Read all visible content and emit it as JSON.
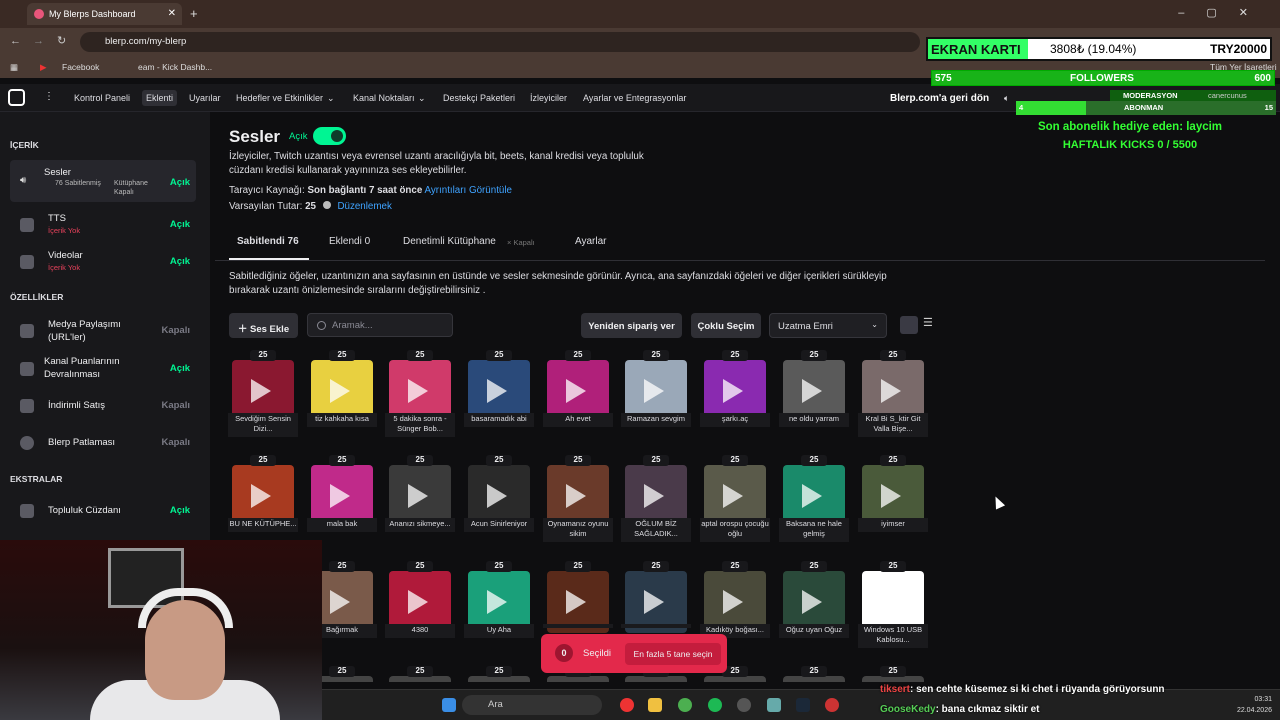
{
  "browser": {
    "tab_title": "My Blerps Dashboard",
    "url": "blerp.com/my-blerp",
    "bookmarks": [
      "Facebook",
      "Kick Dashb..."
    ],
    "bookmark_partial": "eam - Kick Dashb...",
    "other_bookmarks": "Tüm Yer İşaretleri"
  },
  "nav": {
    "items": [
      "Kontrol Paneli",
      "Eklenti",
      "Uyarılar",
      "Hedefler ve Etkinlikler",
      "Kanal Noktaları",
      "Destekçi Paketleri",
      "İzleyiciler",
      "Ayarlar ve Entegrasyonlar"
    ],
    "active": "Eklenti",
    "back": "Blerp.com'a geri dön"
  },
  "sidebar": {
    "section_content": "İÇERİK",
    "section_features": "ÖZELLİKLER",
    "section_extras": "EKSTRALAR",
    "items": [
      {
        "label": "Sesler",
        "sub": "76 Sabitlenmiş",
        "sub2": "Kütüphane Kapalı",
        "status": "Açık"
      },
      {
        "label": "TTS",
        "sub": "İçerik Yok",
        "status": "Açık"
      },
      {
        "label": "Videolar",
        "sub": "İçerik Yok",
        "status": "Açık"
      },
      {
        "label": "Medya Paylaşımı (URL'ler)",
        "status": "Kapalı"
      },
      {
        "label": "Kanal Puanlarının Devralınması",
        "status": "Açık"
      },
      {
        "label": "İndirimli Satış",
        "status": "Kapalı"
      },
      {
        "label": "Blerp Patlaması",
        "status": "Kapalı"
      },
      {
        "label": "Topluluk Cüzdanı",
        "status": "Açık"
      }
    ]
  },
  "main": {
    "title": "Sesler",
    "toggle_label": "Açık",
    "desc": "İzleyiciler, Twitch uzantısı veya evrensel uzantı aracılığıyla bit, beets, kanal kredisi veya topluluk cüzdanı kredisi kullanarak yayınınıza ses ekleyebilirler.",
    "source_label": "Tarayıcı Kaynağı:",
    "source_value": "Son bağlantı 7 saat önce",
    "source_link": "Ayrıntıları Görüntüle",
    "default_label": "Varsayılan Tutar:",
    "default_value": "25",
    "default_link": "Düzenlemek",
    "tabs": [
      "Sabitlendi 76",
      "Eklendi 0",
      "Denetimli Kütüphane",
      "Ayarlar"
    ],
    "tab_off": "× Kapalı",
    "pinned_desc": "Sabitlediğiniz öğeler, uzantınızın ana sayfasının en üstünde ve sesler sekmesinde görünür. Ayrıca, ana sayfanızdaki öğeleri ve diğer içerikleri sürükleyip bırakarak uzantı önizlemesinde sıralarını değiştirebilirsiniz .",
    "add_button": "Ses Ekle",
    "search_placeholder": "Aramak...",
    "reorder_button": "Yeniden sipariş ver",
    "multi_button": "Çoklu Seçim",
    "sort_value": "Uzatma Emri"
  },
  "cards": [
    {
      "cost": "25",
      "name": "Sevdiğim Sensin Dizi...",
      "color": "#8a1830"
    },
    {
      "cost": "25",
      "name": "tiz kahkaha kısa",
      "color": "#e8d040"
    },
    {
      "cost": "25",
      "name": "5 dakika sonra - Sünger Bob...",
      "color": "#d03a6a"
    },
    {
      "cost": "25",
      "name": "basaramadık abi",
      "color": "#2a4a7a"
    },
    {
      "cost": "25",
      "name": "Ah evet",
      "color": "#b0207a"
    },
    {
      "cost": "25",
      "name": "Ramazan sevgim",
      "color": "#9aa8b8"
    },
    {
      "cost": "25",
      "name": "şarkı.aç",
      "color": "#8a2ab0"
    },
    {
      "cost": "25",
      "name": "ne oldu yarram",
      "color": "#5a5a5a"
    },
    {
      "cost": "25",
      "name": "Kral Bi S_ktir Git Valla Bişe...",
      "color": "#7a6a6a"
    },
    {
      "cost": "25",
      "name": "BU NE KÜTÜPHE...",
      "color": "#a83a20"
    },
    {
      "cost": "25",
      "name": "mala bak",
      "color": "#c02a8a"
    },
    {
      "cost": "25",
      "name": "Ananızı sikmeye...",
      "color": "#3a3a3a"
    },
    {
      "cost": "25",
      "name": "Acun Sinirleniyor",
      "color": "#2a2a2a"
    },
    {
      "cost": "25",
      "name": "Oynamanız oyunu sikim",
      "color": "#6a3a2a"
    },
    {
      "cost": "25",
      "name": "OĞLUM BİZ SAĞLADIK...",
      "color": "#4a3a4a"
    },
    {
      "cost": "25",
      "name": "aptal orospu çocuğu oğlu",
      "color": "#5a5a4a"
    },
    {
      "cost": "25",
      "name": "Baksana ne hale gelmiş",
      "color": "#1a8a6a"
    },
    {
      "cost": "25",
      "name": "iyimser",
      "color": "#4a5a3a"
    },
    {
      "cost": "25",
      "name": "Bağırmak",
      "color": "#7a5a4a"
    },
    {
      "cost": "25",
      "name": "4380",
      "color": "#b01a3a"
    },
    {
      "cost": "25",
      "name": "Uy Aha",
      "color": "#1aa07a"
    },
    {
      "cost": "25",
      "name": "",
      "color": "#5a2a1a"
    },
    {
      "cost": "25",
      "name": "",
      "color": "#2a3a4a"
    },
    {
      "cost": "25",
      "name": "Kadıköy boğası...",
      "color": "#4a4a3a"
    },
    {
      "cost": "25",
      "name": "Oğuz uyan Oğuz",
      "color": "#2a4a3a"
    },
    {
      "cost": "25",
      "name": "Windows 10 USB Kablosu...",
      "color": "#ffffff"
    }
  ],
  "bottom_row_costs": [
    "25",
    "25",
    "25",
    "25",
    "25",
    "25",
    "25",
    "25"
  ],
  "toast": {
    "count": "0",
    "label": "Seçildi",
    "button": "En fazla 5 tane seçin"
  },
  "overlay": {
    "ekran_label": "EKRAN KARTI",
    "ekran_value": "3808₺ (19.04%)",
    "ekran_goal": "TRY20000",
    "followers_current": "575",
    "followers_label": "FOLLOWERS",
    "followers_goal": "600",
    "mod_label": "MODERASYON",
    "mod_user": "canercunus",
    "sub_label": "ABONMAN",
    "sub_current": "4",
    "sub_goal": "15",
    "gift": "Son abonelik hediye eden: laycim",
    "kicks": "HAFTALIK KICKS 0 / 5500"
  },
  "chat": [
    {
      "user": "tiksert",
      "text": ": sen cehte küsemez si ki chet i rüyanda görüyorsunn"
    },
    {
      "user": "GooseKedy",
      "text": ": bana cıkmaz siktir et"
    }
  ],
  "taskbar": {
    "search": "Ara",
    "time": "03:31",
    "date": "22.04.2026"
  },
  "colors": {
    "accent": "#00f593",
    "danger": "#e3294b",
    "link": "#3fa3ff"
  }
}
